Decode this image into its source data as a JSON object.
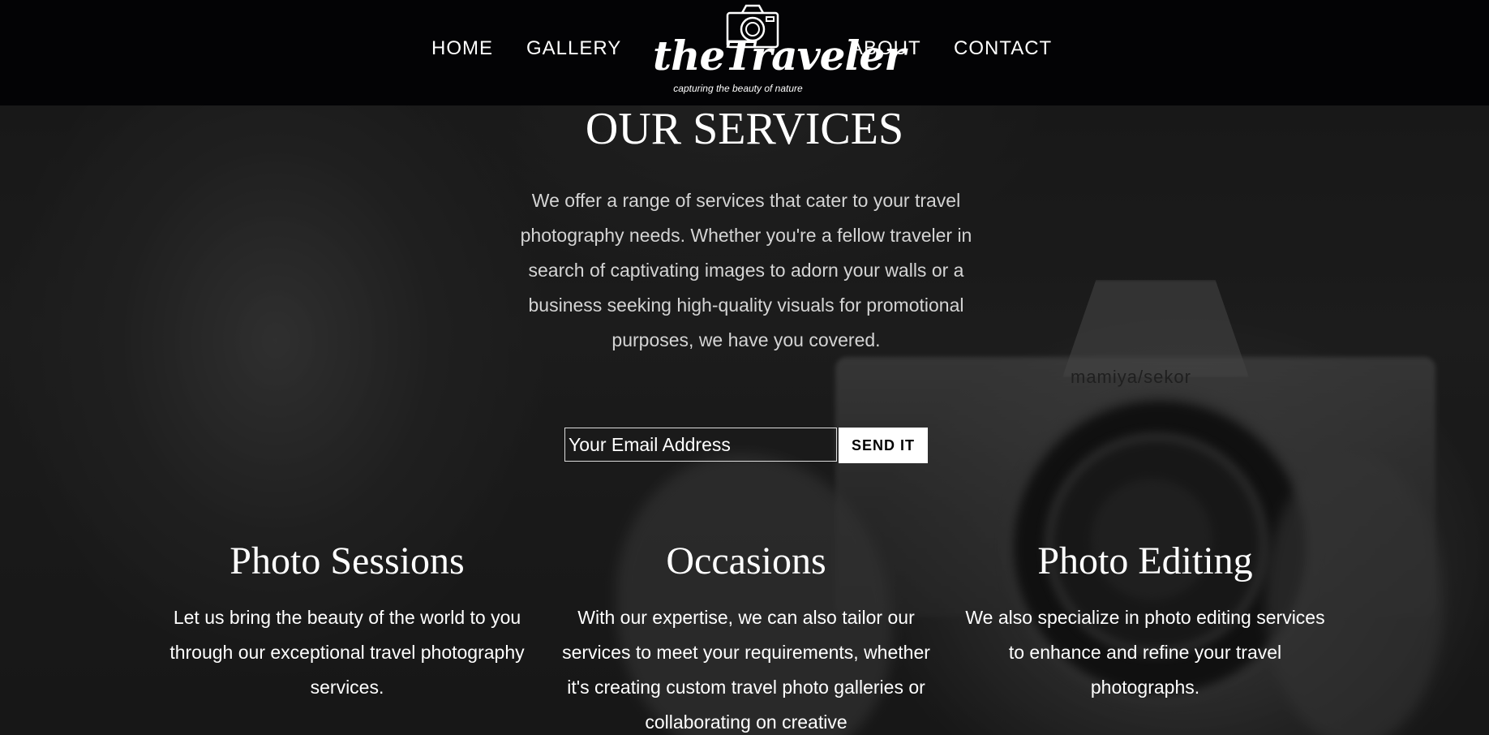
{
  "nav": {
    "home": "HOME",
    "gallery": "GALLERY",
    "about": "ABOUT",
    "contact": "CONTACT"
  },
  "logo": {
    "name": "theTraveler",
    "tagline": "capturing the beauty of nature"
  },
  "background": {
    "camera_brand": "mamiya/sekor"
  },
  "services": {
    "title": "OUR SERVICES",
    "description": "We offer a range of services that cater to your travel photography needs. Whether you're a fellow traveler in search of captivating images to adorn your walls or a business seeking high-quality visuals for promotional purposes, we have you covered."
  },
  "newsletter": {
    "email_placeholder": "Your Email Address",
    "send_label": "SEND IT"
  },
  "columns": [
    {
      "title": "Photo Sessions",
      "text": "Let us bring the beauty of the world to you through our exceptional travel photography services."
    },
    {
      "title": "Occasions",
      "text": "With our expertise, we can also tailor our services to meet your requirements, whether it's creating custom travel photo galleries or collaborating on creative"
    },
    {
      "title": "Photo Editing",
      "text": "We also specialize in photo editing services to enhance and refine your travel photographs."
    }
  ]
}
